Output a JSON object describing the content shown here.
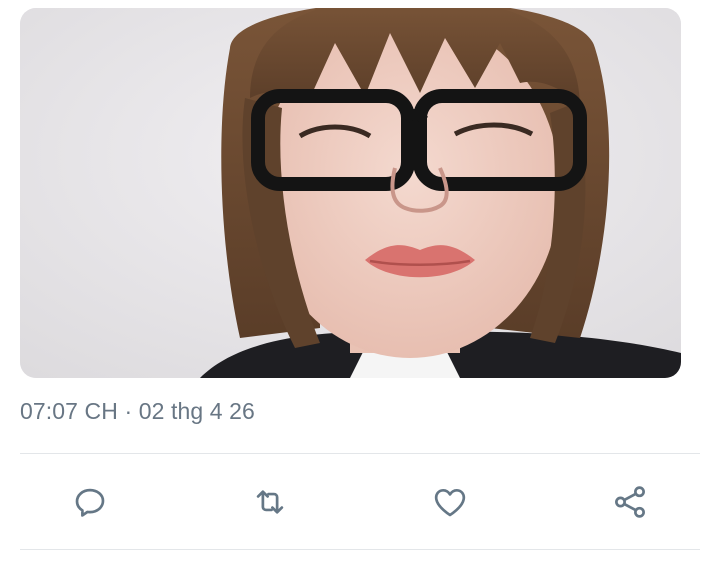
{
  "tweet": {
    "media": {
      "alt": "",
      "colors": {
        "background": "#e7e5e8",
        "hair": "#6b4a32",
        "frames": "#141414",
        "lips": "#d9736f"
      }
    },
    "timestamp": "07:07 CH · 02 thg 4 26"
  },
  "actions": [
    {
      "name": "reply",
      "icon": "reply-icon"
    },
    {
      "name": "retweet",
      "icon": "retweet-icon"
    },
    {
      "name": "like",
      "icon": "heart-icon"
    },
    {
      "name": "share",
      "icon": "share-icon"
    }
  ],
  "colors": {
    "icon": "#657786",
    "text_secondary": "#687684",
    "divider": "#e3e6e9"
  }
}
